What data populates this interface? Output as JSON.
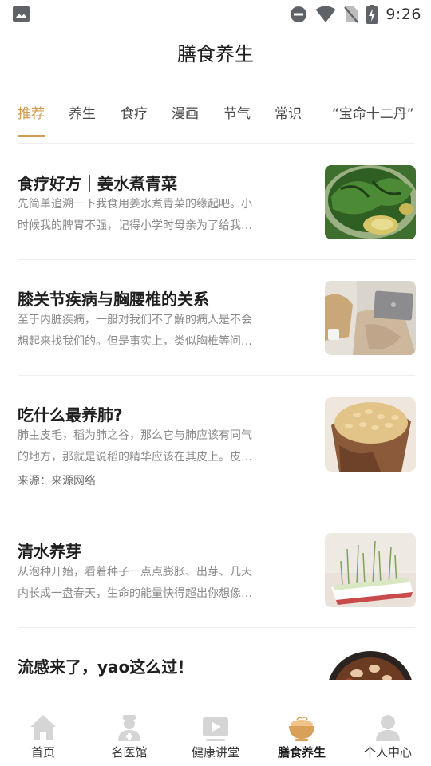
{
  "status_bar": {
    "time": "9:26",
    "icons": [
      "gallery-icon",
      "do-not-disturb-icon",
      "wifi-icon",
      "no-sim-icon",
      "battery-charging-icon"
    ]
  },
  "header": {
    "title": "膳食养生"
  },
  "tabs": [
    {
      "label": "推荐",
      "active": true
    },
    {
      "label": "养生",
      "active": false
    },
    {
      "label": "食疗",
      "active": false
    },
    {
      "label": "漫画",
      "active": false
    },
    {
      "label": "节气",
      "active": false
    },
    {
      "label": "常识",
      "active": false
    },
    {
      "label": "“宝命十二丹”",
      "active": false
    }
  ],
  "articles": [
    {
      "title": "食疗好方｜姜水煮青菜",
      "desc_lines": [
        "先简单追溯一下我食用姜水煮青菜的缘起吧。小",
        "时候我的脾胃不强，记得小学时母亲为了给我…"
      ],
      "source": "",
      "thumb": "boiled-greens-ginger-photo"
    },
    {
      "title": "膝关节疾病与胸腰椎的关系",
      "desc_lines": [
        "至于内脏疾病，一般对我们不了解的病人是不会",
        "想起来找我们的。但是事实上，类似胸椎等问…"
      ],
      "source": "",
      "thumb": "laptop-on-sofa-photo"
    },
    {
      "title": "吃什么最养肺?",
      "desc_lines": [
        "肺主皮毛，稻为肺之谷，那么它与肺应该有同气",
        "的地方，那就是说稻的精华应该在其皮上。皮…"
      ],
      "source": "来源：来源网络",
      "thumb": "rice-grains-photo"
    },
    {
      "title": "清水养芽",
      "desc_lines": [
        "从泡种开始，看着种子一点点膨胀、出芽、几天",
        "内长成一盘春天，生命的能量快得超出你想像…"
      ],
      "source": "",
      "thumb": "sprouts-tray-photo"
    },
    {
      "title": "流感来了，yao这么过！",
      "desc_lines": [],
      "source": "",
      "thumb": "stew-bowl-photo"
    }
  ],
  "bottom_nav": [
    {
      "label": "首页",
      "icon": "home-icon",
      "active": false
    },
    {
      "label": "名医馆",
      "icon": "doctor-icon",
      "active": false
    },
    {
      "label": "健康讲堂",
      "icon": "video-play-icon",
      "active": false
    },
    {
      "label": "膳食养生",
      "icon": "bowl-icon",
      "active": true
    },
    {
      "label": "个人中心",
      "icon": "person-icon",
      "active": false
    }
  ],
  "colors": {
    "accent": "#d29a52",
    "nav_inactive_icon": "#d5d5d5",
    "nav_active_icon": "#d9a05a"
  }
}
